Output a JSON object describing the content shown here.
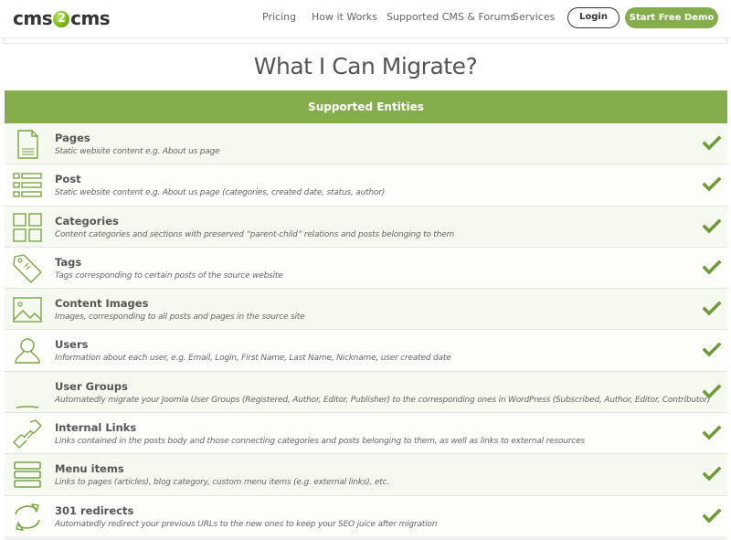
{
  "header": {
    "logo": {
      "left": "cms",
      "middle": "2",
      "right": "cms"
    },
    "nav": [
      "Pricing",
      "How it Works",
      "Supported CMS & Forums",
      "Services"
    ],
    "login_label": "Login",
    "demo_label": "Start Free Demo"
  },
  "page": {
    "title": "What I Can Migrate?"
  },
  "table": {
    "header": "Supported Entities",
    "rows": [
      {
        "title": "Pages",
        "desc": "Static website content e.g. About us page",
        "icon": "page-icon",
        "supported": true
      },
      {
        "title": "Post",
        "desc": "Static website content e.g. About us page (categories, created date, status, author)",
        "icon": "list-icon",
        "supported": true
      },
      {
        "title": "Categories",
        "desc": "Content categories and sections with preserved “parent-child” relations and posts belonging to them",
        "icon": "grid-icon",
        "supported": true
      },
      {
        "title": "Tags",
        "desc": "Tags corresponding to certain posts of the source website",
        "icon": "tag-icon",
        "supported": true
      },
      {
        "title": "Content Images",
        "desc": "Images, corresponding to all posts and pages in the source site",
        "icon": "image-icon",
        "supported": true
      },
      {
        "title": "Users",
        "desc": "Information about each user, e.g. Email, Login, First Name, Last Name, Nickname, user created date",
        "icon": "user-icon",
        "supported": true
      },
      {
        "title": "User Groups",
        "desc": "Automatedly migrate your Joomla User Groups (Registered, Author, Editor, Publisher) to the corresponding ones in WordPress (Subscribed, Author, Editor, Contributor)",
        "icon": "user-group-icon",
        "supported": true
      },
      {
        "title": "Internal Links",
        "desc": "Links contained in the posts body and those connecting categories and posts belonging to them, as well as links to external resources",
        "icon": "link-icon",
        "supported": true
      },
      {
        "title": "Menu items",
        "desc": "Links to pages (articles), blog category, custom menu items (e.g. external links), etc.",
        "icon": "menu-icon",
        "supported": true
      },
      {
        "title": "301 redirects",
        "desc": "Automatedly redirect your previous URLs to the new ones to keep your SEO juice after migration",
        "icon": "redirect-icon",
        "supported": true
      }
    ]
  },
  "colors": {
    "brand_green": "#86ad4c",
    "check_green": "#6f9a3a",
    "icon_green": "#7aa544"
  }
}
